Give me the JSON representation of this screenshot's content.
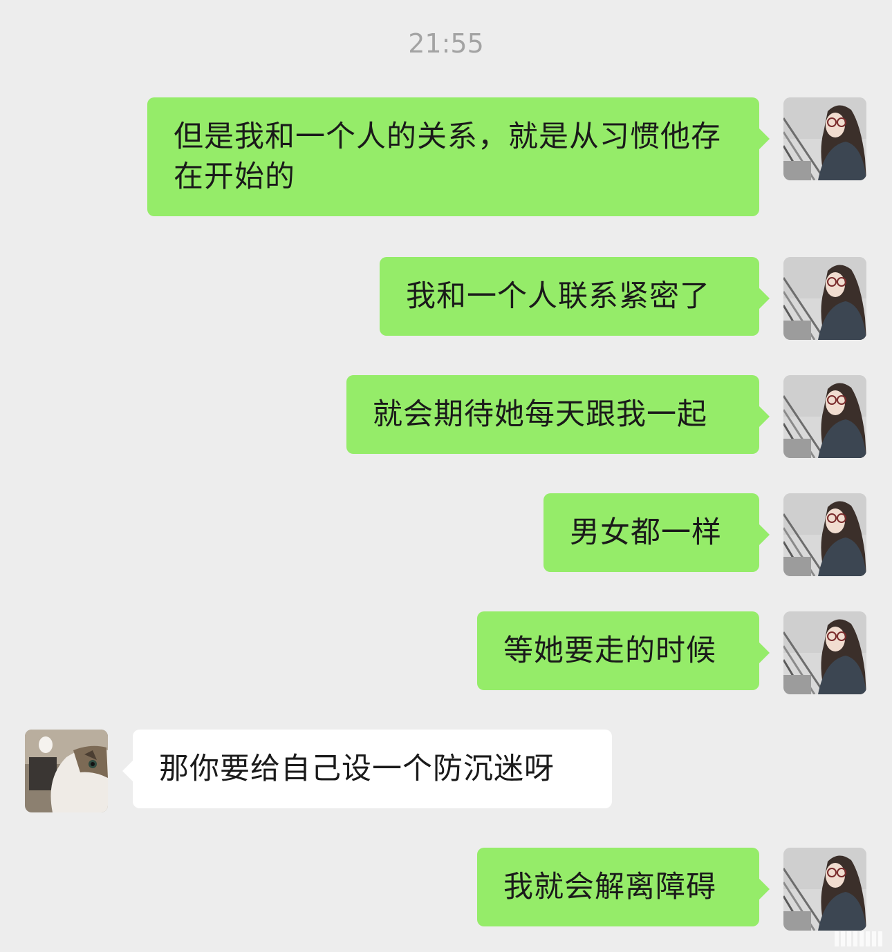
{
  "chat": {
    "timestamp": "21:55",
    "messages": [
      {
        "from": "me",
        "text": "但是我和一个人的关系，就是从习惯他存在开始的"
      },
      {
        "from": "me",
        "text": "我和一个人联系紧密了"
      },
      {
        "from": "me",
        "text": "就会期待她每天跟我一起"
      },
      {
        "from": "me",
        "text": "男女都一样"
      },
      {
        "from": "me",
        "text": "等她要走的时候"
      },
      {
        "from": "other",
        "text": "那你要给自己设一个防沉迷呀"
      },
      {
        "from": "me",
        "text": "我就会解离障碍"
      }
    ]
  },
  "avatars": {
    "me": "girl-with-glasses-avatar",
    "other": "cat-avatar"
  },
  "colors": {
    "background": "#ededed",
    "outgoing_bubble": "#95ec69",
    "incoming_bubble": "#ffffff",
    "timestamp_text": "#a3a3a3"
  }
}
